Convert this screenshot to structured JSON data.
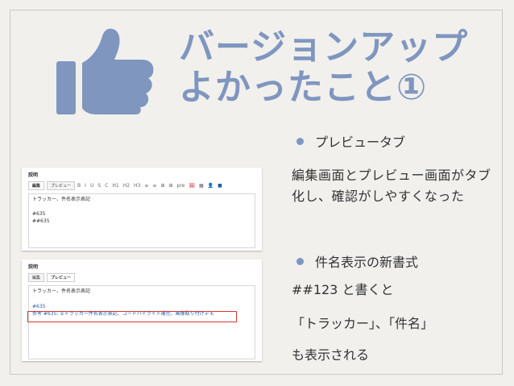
{
  "slide": {
    "title_line1": "バージョンアップ",
    "title_line2": "よかったこと①",
    "bullet1": "プレビュータブ",
    "desc1": "編集画面とプレビュー画面がタブ化し、確認がしやすくなった",
    "bullet2": "件名表示の新書式",
    "syntax": "##123 と書くと",
    "result": "「トラッカー」、「件名」",
    "result2": "も表示される",
    "accent_color": "#7f96bf"
  },
  "screenshot1": {
    "heading": "説明",
    "tab_edit": "編集",
    "tab_preview": "プレビュー",
    "toolbar_items": [
      "B",
      "I",
      "U",
      "S",
      "C",
      "H1",
      "H2",
      "H3",
      "≡",
      "≡",
      "⊞",
      "⊞",
      "pre",
      "🖼",
      "▦",
      "👤",
      "■"
    ],
    "lines": [
      "トラッカー、件名表示表記",
      "",
      "#635",
      "##635"
    ]
  },
  "screenshot2": {
    "heading": "説明",
    "tab_edit": "編集",
    "tab_preview": "プレビュー",
    "line1": "トラッカー、件名表示表記",
    "link": "#635",
    "ref_line": "参考 #635: ①トラッカー件名表示表記、コードハイライト補完、画像貼り付けデモ"
  }
}
